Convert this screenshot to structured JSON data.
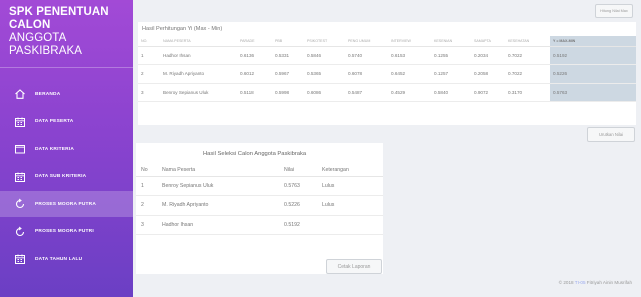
{
  "sidebar": {
    "brand_line1": "SPK PENENTUAN CALON",
    "brand_line2": "ANGGOTA PASKIBRAKA",
    "items": [
      {
        "label": "BERANDA",
        "icon": "home-icon"
      },
      {
        "label": "DATA PESERTA",
        "icon": "calendar-icon"
      },
      {
        "label": "DATA KRITERIA",
        "icon": "window-icon"
      },
      {
        "label": "DATA SUB KRITERIA",
        "icon": "calendar-icon"
      },
      {
        "label": "PROSES MOORA PUTRA",
        "icon": "refresh-icon"
      },
      {
        "label": "PROSES MOORA PUTRI",
        "icon": "refresh-icon"
      },
      {
        "label": "DATA TAHUN LALU",
        "icon": "calendar-icon"
      }
    ]
  },
  "top_button": "Hitung Nilai Max",
  "results": {
    "title": "Hasil Perhitungan Yi (Max - Min)",
    "columns": [
      "NO.",
      "NAMA PESERTA",
      "PARADE",
      "PBB",
      "PSIKOTEST",
      "PENG UMUM",
      "INTERVIEW",
      "KESENIAN",
      "SAMAPTA",
      "KESEHATAN",
      "Y = MAX-MIN"
    ],
    "rows": [
      [
        "1",
        "Hadhor Ihsan",
        "0.6136",
        "0.5331",
        "0.5846",
        "0.5740",
        "0.6153",
        "0.1255",
        "0.2034",
        "0.7022",
        "0.5192"
      ],
      [
        "2",
        "M. Riyadh Apriyanto",
        "0.6012",
        "0.5967",
        "0.5365",
        "0.6078",
        "0.6452",
        "0.1257",
        "0.2058",
        "0.7022",
        "0.5226"
      ],
      [
        "3",
        "Benroy Sepianus Uluk",
        "0.5118",
        "0.5998",
        "0.6086",
        "0.5487",
        "0.4529",
        "0.5840",
        "0.9072",
        "0.3170",
        "0.5763"
      ]
    ]
  },
  "sort_button": "Urutkan Nilai",
  "selection": {
    "title": "Hasil Seleksi Calon Anggota Paskibraka",
    "columns": [
      "No",
      "Nama Peserta",
      "Nilai",
      "Keterangan"
    ],
    "rows": [
      [
        "1",
        "Benroy Sepianus Uluk",
        "0.5763",
        "Lulus"
      ],
      [
        "2",
        "M. Riyadh Apriyanto",
        "0.5226",
        "Lulus"
      ],
      [
        "3",
        "Hadhor Ihsan",
        "0.5192",
        ""
      ]
    ],
    "print_button": "Cetak Laporan"
  },
  "footer": {
    "prefix": "© 2018 ",
    "highlight": "TI-05",
    "suffix": " Fitriyah Ainin Musrifah"
  }
}
